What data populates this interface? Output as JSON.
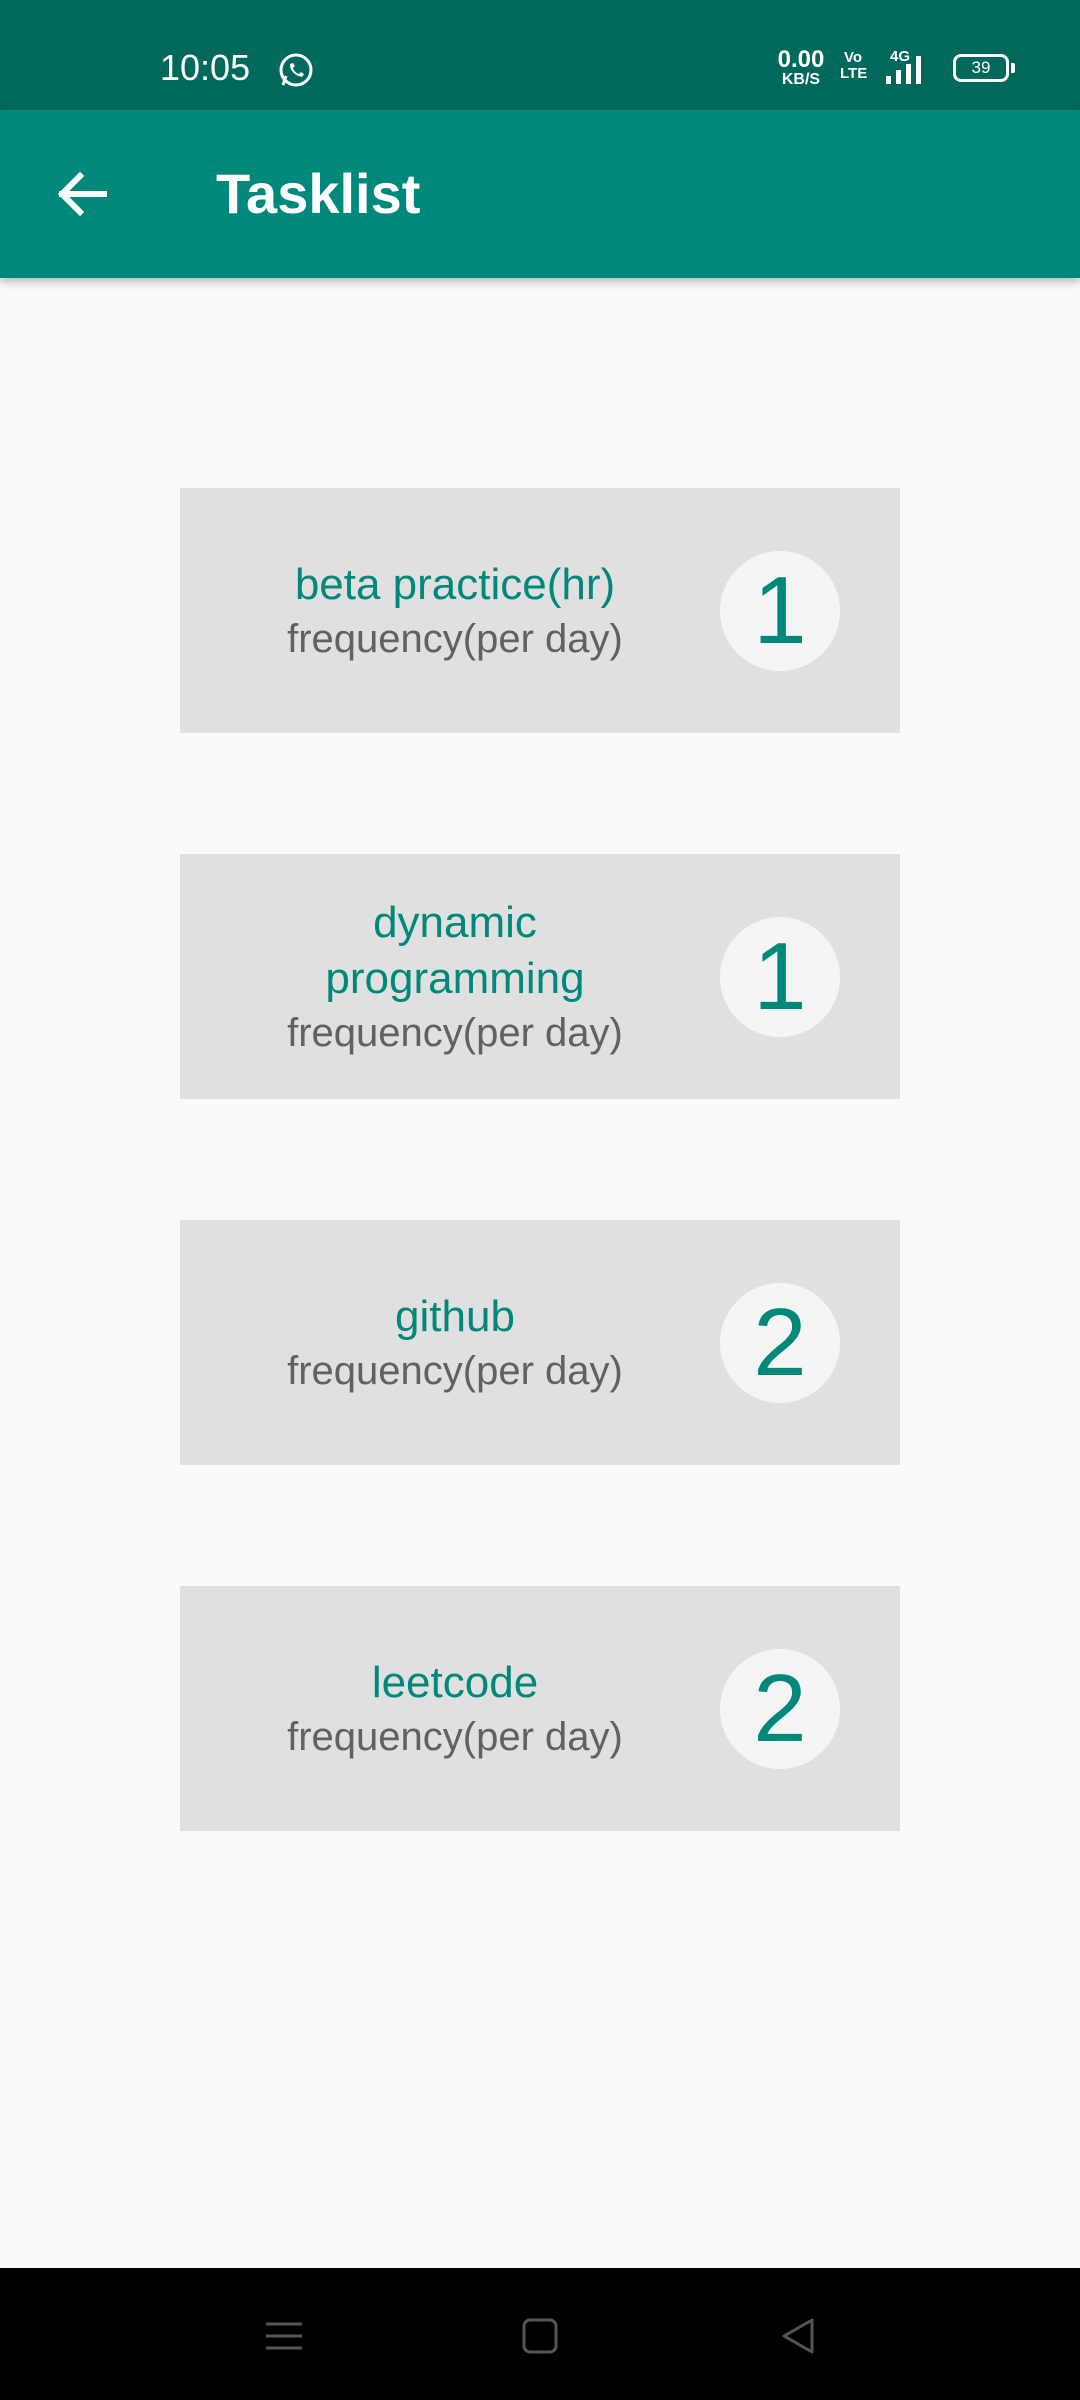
{
  "status_bar": {
    "time": "10:05",
    "net_speed_value": "0.00",
    "net_speed_unit": "KB/S",
    "volte_top": "Vo",
    "volte_bottom": "LTE",
    "network": "4G",
    "battery": "39",
    "icons": [
      "whatsapp-icon",
      "signal-icon",
      "battery-icon"
    ]
  },
  "app_bar": {
    "title": "Tasklist",
    "back_icon": "arrow-left-icon",
    "color": "#00897b"
  },
  "tasks": [
    {
      "name": "beta practice(hr)",
      "subtitle": "frequency(per day)",
      "count": "1"
    },
    {
      "name": "dynamic programming",
      "subtitle": "frequency(per day)",
      "count": "1"
    },
    {
      "name": "github",
      "subtitle": "frequency(per day)",
      "count": "2"
    },
    {
      "name": "leetcode",
      "subtitle": "frequency(per day)",
      "count": "2"
    }
  ],
  "nav_bar": {
    "buttons": [
      "menu-icon",
      "home-icon",
      "back-triangle-icon"
    ]
  },
  "colors": {
    "status_bar": "#00695c",
    "accent": "#00897b",
    "card": "#e0e0e0",
    "subtitle": "#616161"
  }
}
